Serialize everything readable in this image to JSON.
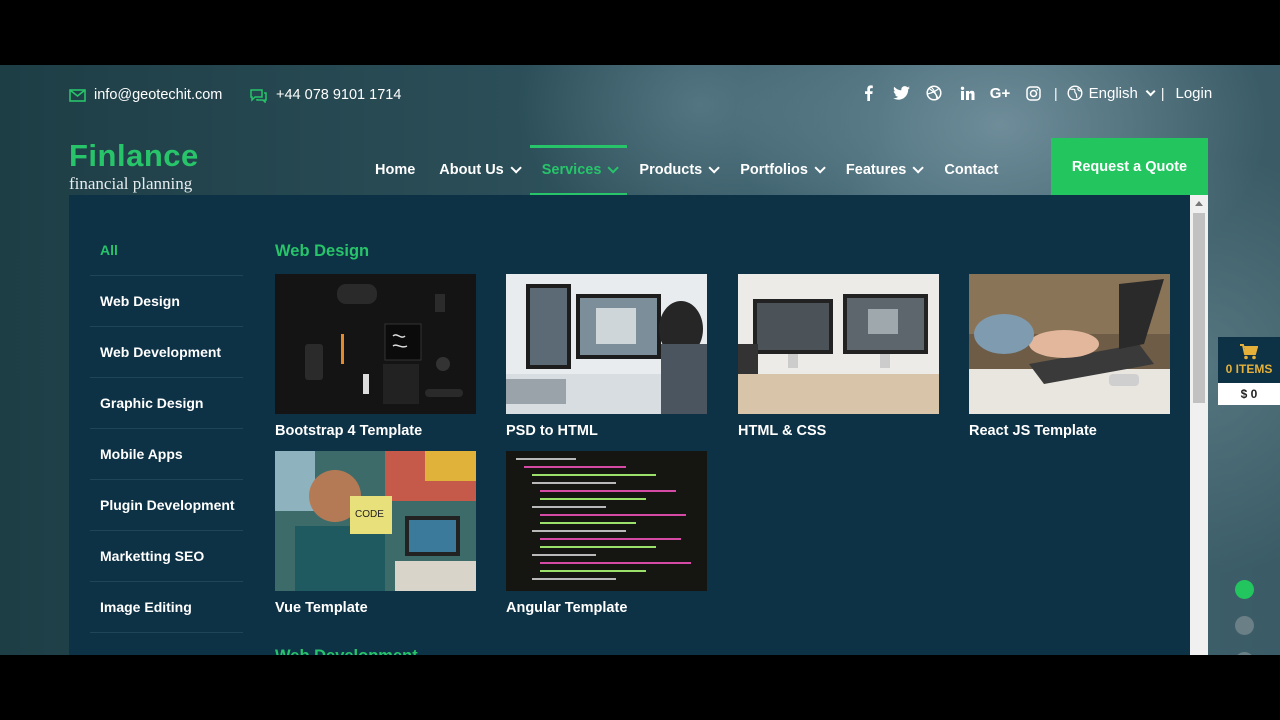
{
  "topbar": {
    "email": "info@geotechit.com",
    "phone": "+44 078 9101 1714",
    "social": [
      "facebook-icon",
      "twitter-icon",
      "dribbble-icon",
      "linkedin-icon",
      "google-plus-icon",
      "instagram-icon"
    ],
    "separator": "|",
    "language": "English",
    "login": "Login"
  },
  "logo": {
    "name": "Finlance",
    "tagline": "financial planning"
  },
  "nav": {
    "items": [
      {
        "label": "Home",
        "dropdown": false
      },
      {
        "label": "About Us",
        "dropdown": true
      },
      {
        "label": "Services",
        "dropdown": true,
        "active": true
      },
      {
        "label": "Products",
        "dropdown": true
      },
      {
        "label": "Portfolios",
        "dropdown": true
      },
      {
        "label": "Features",
        "dropdown": true
      },
      {
        "label": "Contact",
        "dropdown": false
      }
    ],
    "quote_button": "Request a Quote"
  },
  "mega_menu": {
    "categories": [
      "All",
      "Web Design",
      "Web Development",
      "Graphic Design",
      "Mobile Apps",
      "Plugin Development",
      "Marketting SEO",
      "Image Editing"
    ],
    "active_category": "All",
    "sections": [
      {
        "title": "Web Design",
        "items": [
          "Bootstrap 4 Template",
          "PSD to HTML",
          "HTML & CSS",
          "React JS Template",
          "Vue Template",
          "Angular Template"
        ]
      },
      {
        "title": "Web Development"
      }
    ]
  },
  "cart": {
    "items_label": "0 ITEMS",
    "total": "$ 0"
  },
  "colors": {
    "accent": "#27c46a",
    "panel": "#0d3145",
    "button": "#22c55e",
    "cart_text": "#e6b13a"
  }
}
